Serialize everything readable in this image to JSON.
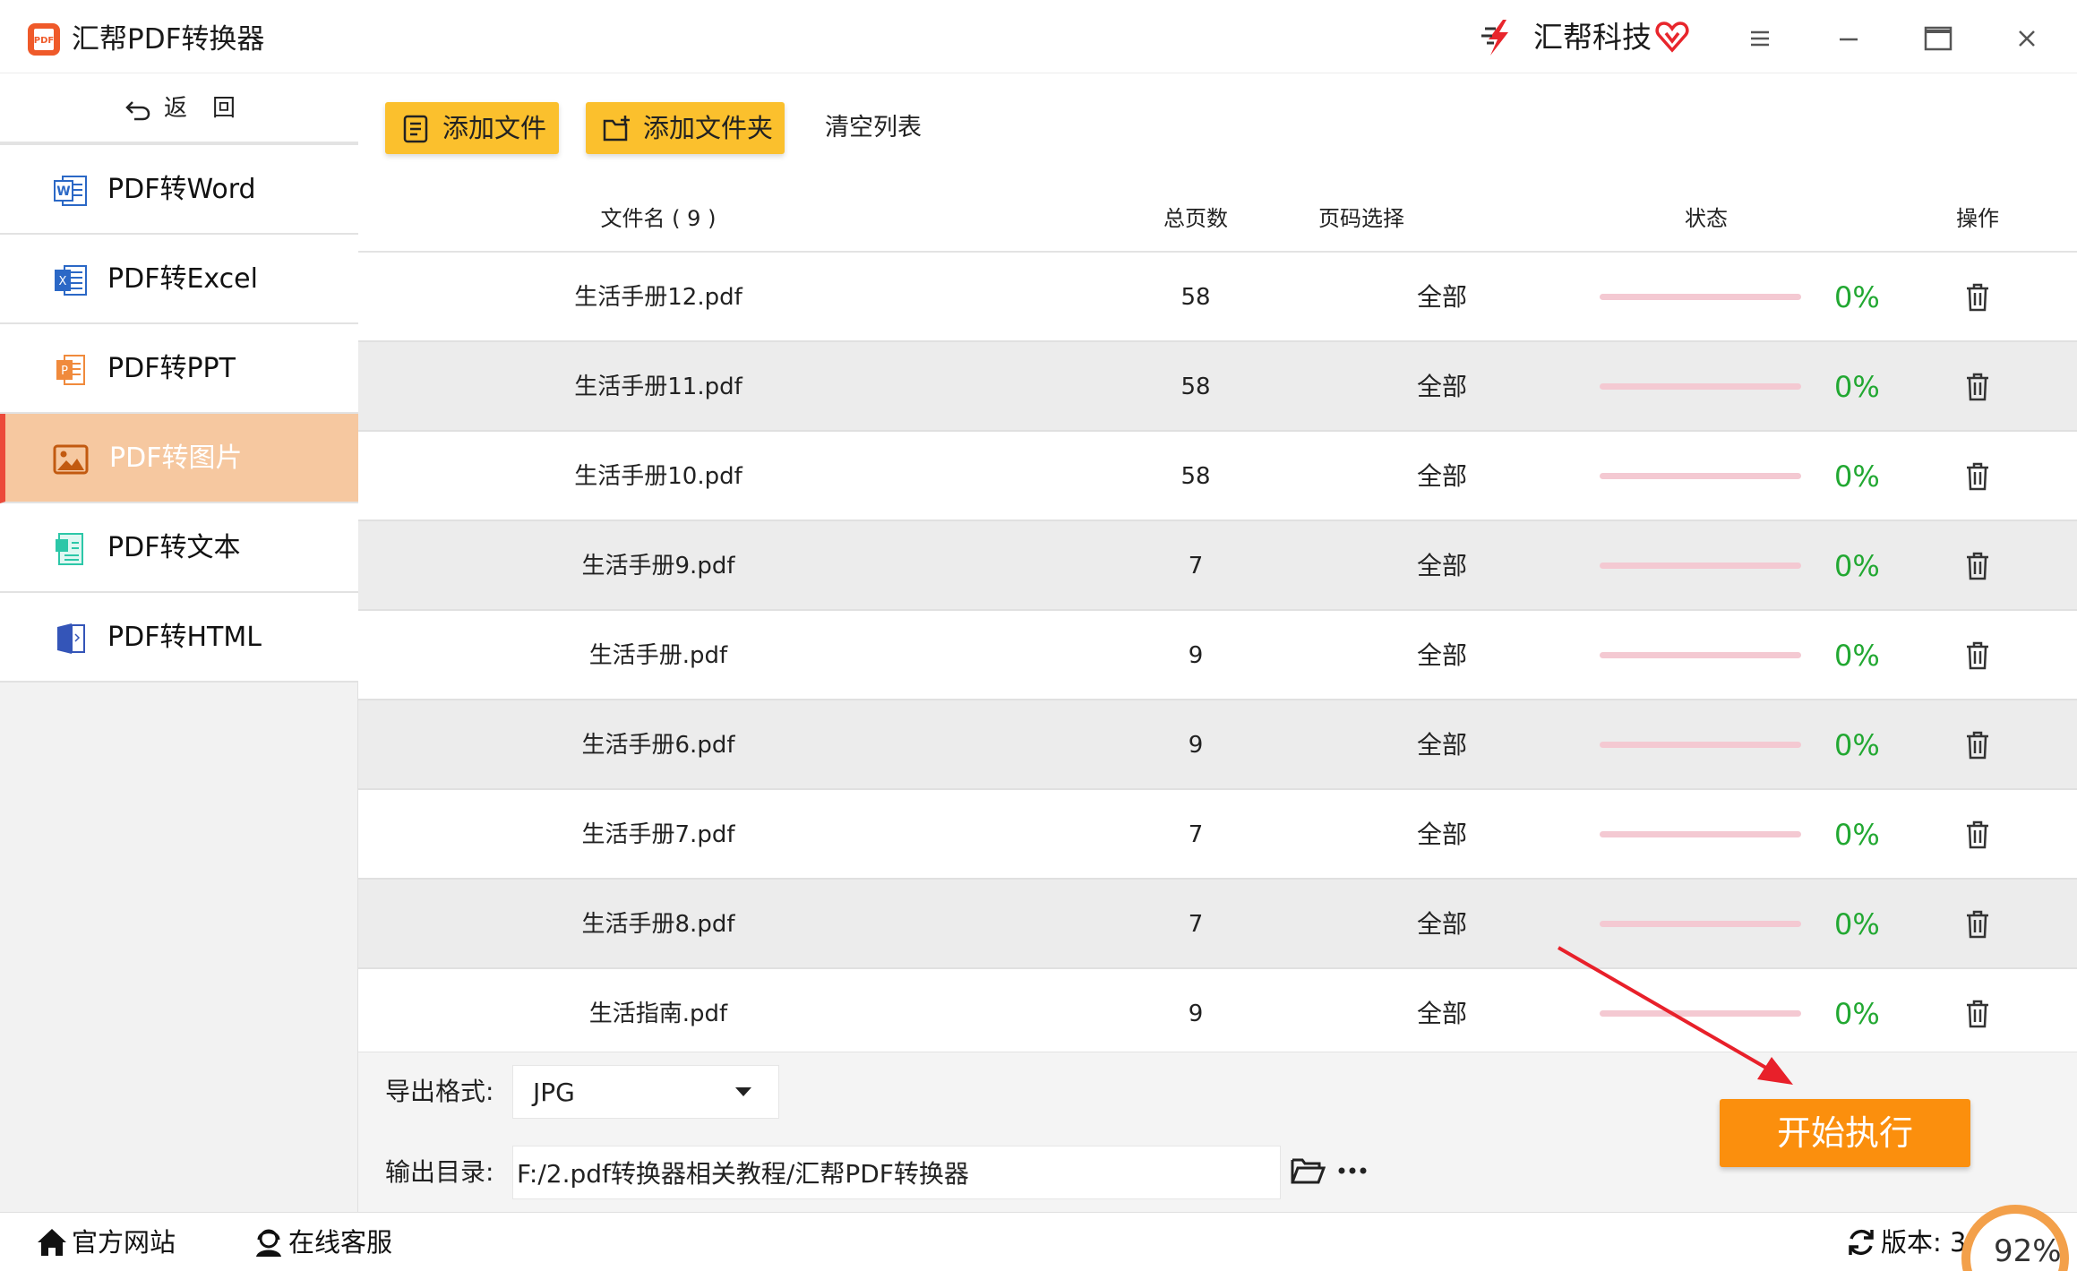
{
  "app": {
    "title": "汇帮PDF转换器",
    "brand": "汇帮科技"
  },
  "colors": {
    "accent_yellow": "#fbc02d",
    "accent_orange": "#fb8f0d",
    "active_nav_bg": "#f6c8a0",
    "active_nav_bar": "#ec4a3a",
    "progress_track": "#f4c9d2",
    "percent_green": "#22a832",
    "annotation_red": "#e8202a"
  },
  "sidebar": {
    "back_label": "返回",
    "items": [
      {
        "label": "PDF转Word",
        "icon": "word-icon",
        "active": false
      },
      {
        "label": "PDF转Excel",
        "icon": "excel-icon",
        "active": false
      },
      {
        "label": "PDF转PPT",
        "icon": "ppt-icon",
        "active": false
      },
      {
        "label": "PDF转图片",
        "icon": "image-icon",
        "active": true
      },
      {
        "label": "PDF转文本",
        "icon": "text-icon",
        "active": false
      },
      {
        "label": "PDF转HTML",
        "icon": "html-icon",
        "active": false
      }
    ]
  },
  "toolbar": {
    "add_file": "添加文件",
    "add_folder": "添加文件夹",
    "clear_list": "清空列表"
  },
  "table": {
    "headers": {
      "name": "文件名 ( 9 )",
      "pages": "总页数",
      "range": "页码选择",
      "status": "状态",
      "ops": "操作"
    },
    "rows": [
      {
        "name": "生活手册12.pdf",
        "pages": "58",
        "range": "全部",
        "progress": 0,
        "percent": "0%"
      },
      {
        "name": "生活手册11.pdf",
        "pages": "58",
        "range": "全部",
        "progress": 0,
        "percent": "0%"
      },
      {
        "name": "生活手册10.pdf",
        "pages": "58",
        "range": "全部",
        "progress": 0,
        "percent": "0%"
      },
      {
        "name": "生活手册9.pdf",
        "pages": "7",
        "range": "全部",
        "progress": 0,
        "percent": "0%"
      },
      {
        "name": "生活手册.pdf",
        "pages": "9",
        "range": "全部",
        "progress": 0,
        "percent": "0%"
      },
      {
        "name": "生活手册6.pdf",
        "pages": "9",
        "range": "全部",
        "progress": 0,
        "percent": "0%"
      },
      {
        "name": "生活手册7.pdf",
        "pages": "7",
        "range": "全部",
        "progress": 0,
        "percent": "0%"
      },
      {
        "name": "生活手册8.pdf",
        "pages": "7",
        "range": "全部",
        "progress": 0,
        "percent": "0%"
      },
      {
        "name": "生活指南.pdf",
        "pages": "9",
        "range": "全部",
        "progress": 0,
        "percent": "0%"
      }
    ]
  },
  "options": {
    "format_label": "导出格式:",
    "format_value": "JPG",
    "dir_label": "输出目录:",
    "dir_value": "F:/2.pdf转换器相关教程/汇帮PDF转换器",
    "start_label": "开始执行"
  },
  "footer": {
    "site": "官方网站",
    "service": "在线客服",
    "version": "版本: 3",
    "badge": "92%"
  }
}
